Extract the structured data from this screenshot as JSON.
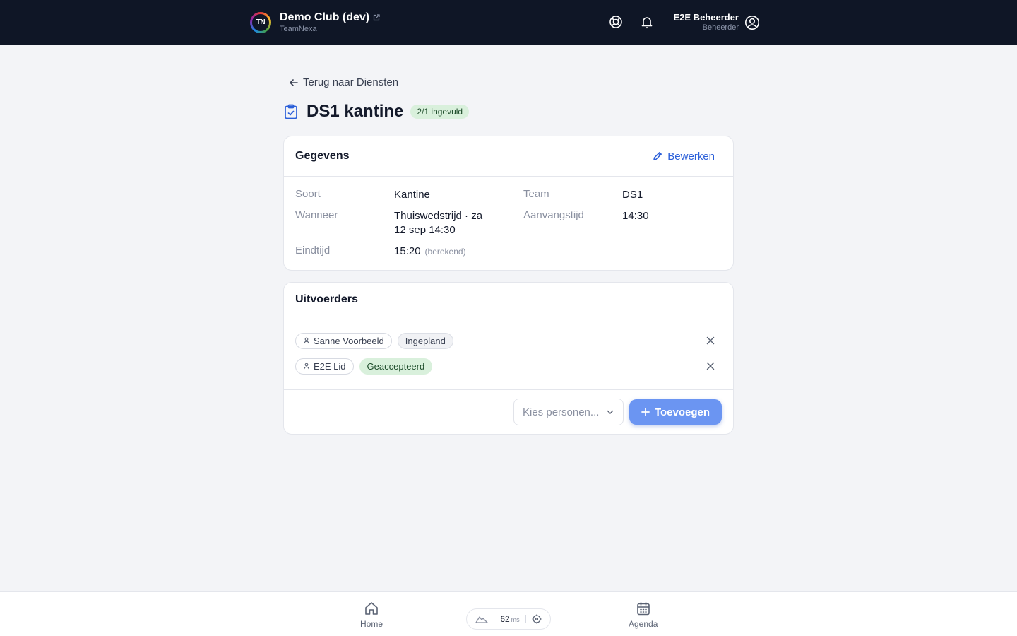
{
  "header": {
    "club_name": "Demo Club (dev)",
    "org_name": "TeamNexa",
    "logo_text": "TN",
    "user_name": "E2E Beheerder",
    "user_role": "Beheerder"
  },
  "back_link": "Terug naar Diensten",
  "page": {
    "title": "DS1 kantine",
    "fill_badge": "2/1 ingevuld"
  },
  "details_card": {
    "title": "Gegevens",
    "edit_label": "Bewerken",
    "fields": {
      "soort_label": "Soort",
      "soort_value": "Kantine",
      "team_label": "Team",
      "team_value": "DS1",
      "wanneer_label": "Wanneer",
      "wanneer_value_line1": "Thuiswedstrijd · za",
      "wanneer_value_line2": "12 sep 14:30",
      "aanvang_label": "Aanvangstijd",
      "aanvang_value": "14:30",
      "eind_label": "Eindtijd",
      "eind_value": "15:20",
      "eind_note": "(berekend)"
    }
  },
  "performers_card": {
    "title": "Uitvoerders",
    "performers": [
      {
        "name": "Sanne Voorbeeld",
        "status": "Ingepland"
      },
      {
        "name": "E2E Lid",
        "status": "Geaccepteerd"
      }
    ],
    "select_placeholder": "Kies personen...",
    "add_label": "Toevoegen"
  },
  "bottom_nav": {
    "home_label": "Home",
    "agenda_label": "Agenda",
    "latency_value": "62",
    "latency_unit": "ms"
  },
  "colors": {
    "topbar": "#0f1626",
    "accent": "#2b5fd9",
    "add_button": "#6b95f2",
    "success_bg": "#d9f0dc"
  }
}
